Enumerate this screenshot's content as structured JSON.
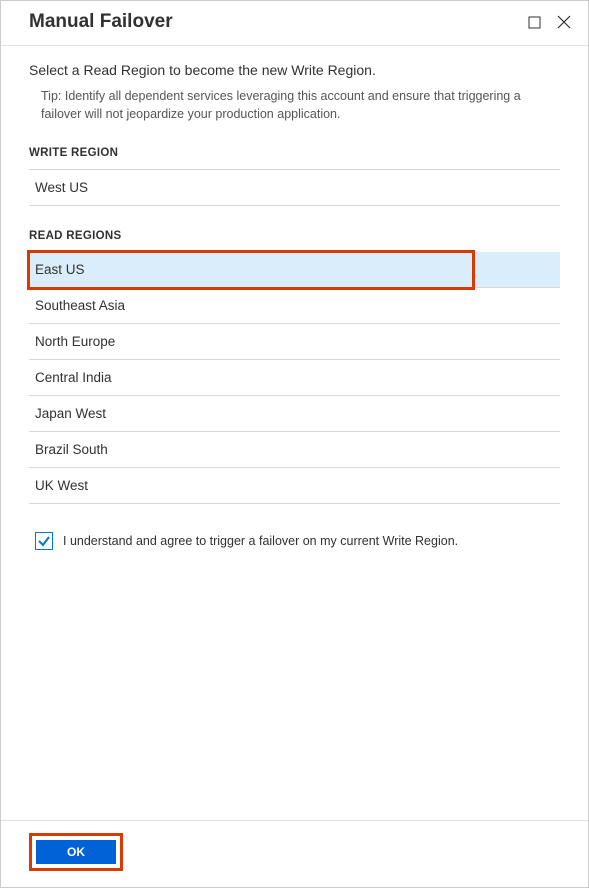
{
  "header": {
    "title": "Manual Failover"
  },
  "main": {
    "instruction": "Select a Read Region to become the new Write Region.",
    "tip": "Tip: Identify all dependent services leveraging this account and ensure that triggering a failover will not jeopardize your production application.",
    "write_region_label": "WRITE REGION",
    "write_region_value": "West US",
    "read_regions_label": "READ REGIONS",
    "read_regions": [
      {
        "name": "East US",
        "selected": true
      },
      {
        "name": "Southeast Asia",
        "selected": false
      },
      {
        "name": "North Europe",
        "selected": false
      },
      {
        "name": "Central India",
        "selected": false
      },
      {
        "name": "Japan West",
        "selected": false
      },
      {
        "name": "Brazil South",
        "selected": false
      },
      {
        "name": "UK West",
        "selected": false
      }
    ],
    "confirm_checked": true,
    "confirm_text": "I understand and agree to trigger a failover on my current Write Region."
  },
  "footer": {
    "ok_label": "OK"
  }
}
